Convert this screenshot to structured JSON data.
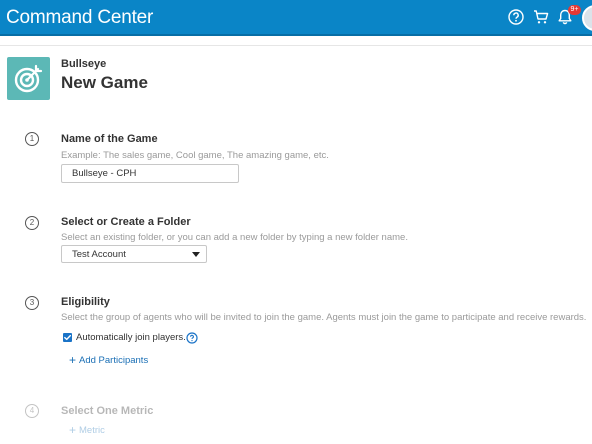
{
  "header": {
    "title": "Command Center",
    "icons": [
      "help-icon",
      "cart-icon",
      "bell-icon"
    ],
    "notification_badge": "9+",
    "bar_color": "#0a85c7"
  },
  "game": {
    "type": "Bullseye",
    "title": "New Game",
    "icon": "target-icon",
    "icon_color": "#5cb8b6"
  },
  "steps": [
    {
      "number": "1",
      "title": "Name of the Game",
      "hint": "Example: The sales game, Cool game, The amazing game, etc.",
      "input_value": "Bullseye - CPH"
    },
    {
      "number": "2",
      "title": "Select or Create a Folder",
      "hint": "Select an existing folder, or you can add a new folder by typing a new folder name.",
      "selected_value": "Test Account"
    },
    {
      "number": "3",
      "title": "Eligibility",
      "hint": "Select the group of agents who will be invited to join the game. Agents must join the game to participate and receive rewards.",
      "checkbox_label": "Automatically join players.",
      "checkbox_checked": true,
      "add_link": "Add Participants"
    },
    {
      "number": "4",
      "title": "Select One Metric",
      "add_link": "Metric",
      "state": "disabled"
    }
  ],
  "accent_link_color": "#1a6fb5"
}
